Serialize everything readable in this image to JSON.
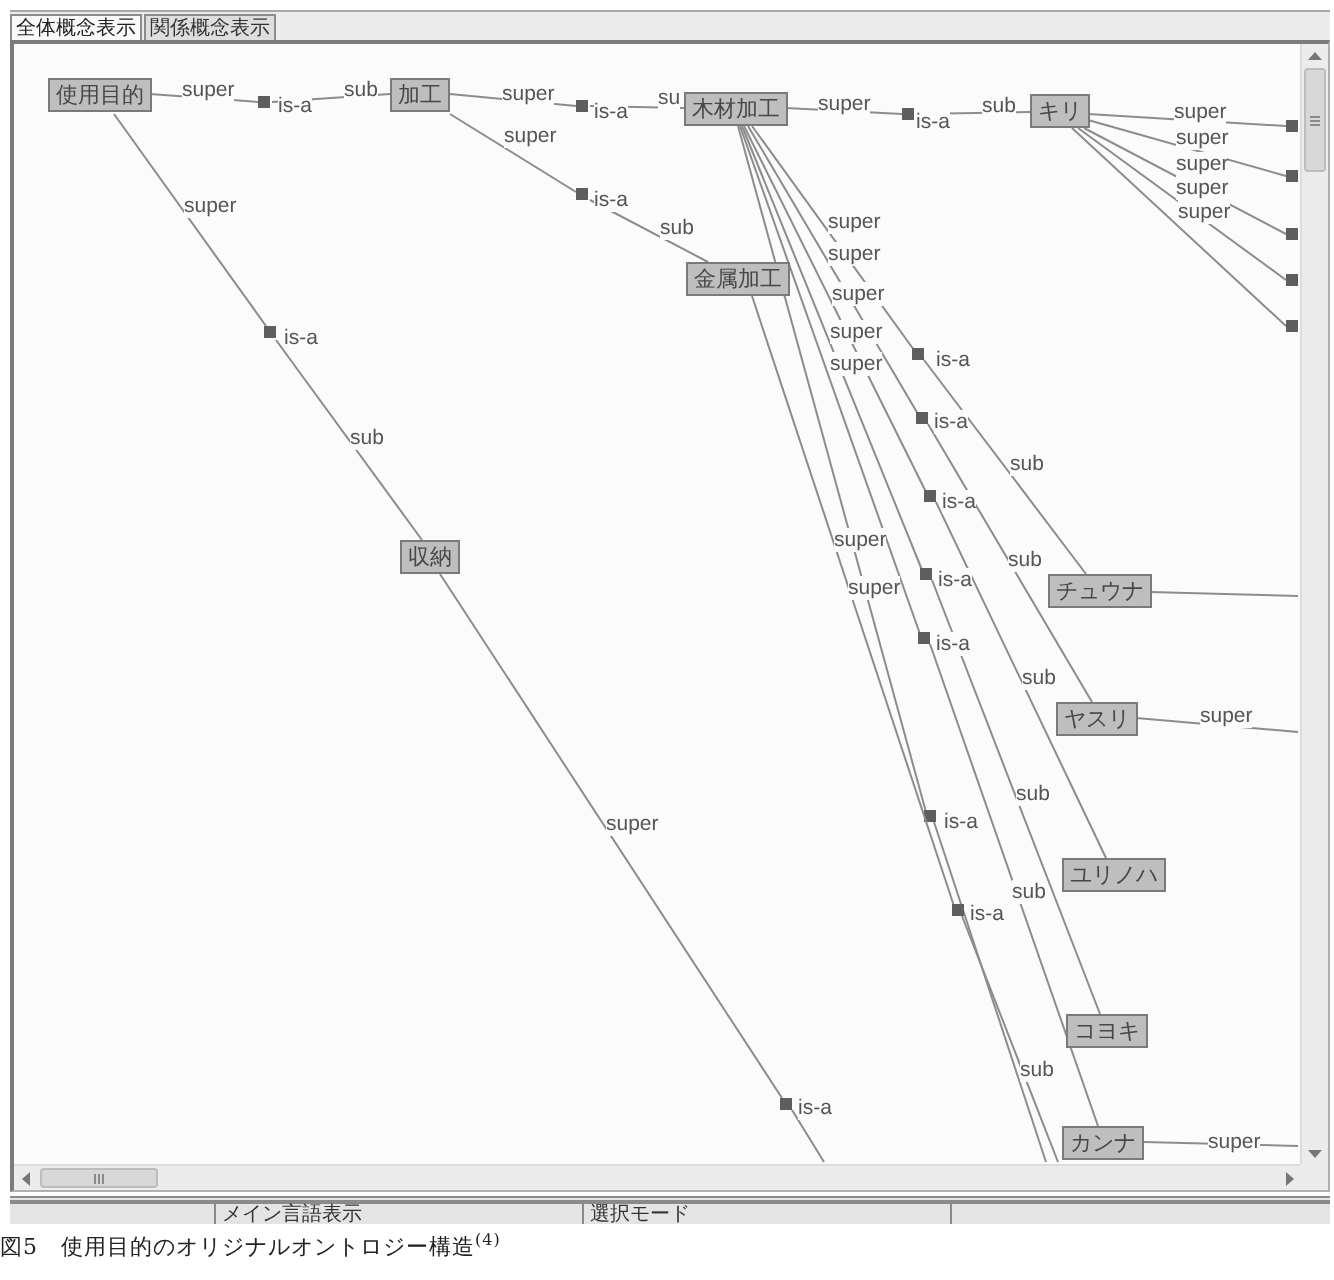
{
  "tabs": [
    {
      "label": "全体概念表示",
      "selected": true
    },
    {
      "label": "関係概念表示",
      "selected": false
    }
  ],
  "diagram": {
    "nodes": [
      {
        "label": "使用目的"
      },
      {
        "label": "加工"
      },
      {
        "label": "木材加工"
      },
      {
        "label": "キリ"
      },
      {
        "label": "金属加工"
      },
      {
        "label": "収納"
      },
      {
        "label": "チュウナ"
      },
      {
        "label": "ヤスリ"
      },
      {
        "label": "ユリノハ"
      },
      {
        "label": "コヨキ"
      },
      {
        "label": "カンナ"
      }
    ],
    "relations": [
      {
        "super": "super",
        "marker": "is-a",
        "sub": "sub"
      },
      {
        "super": "super",
        "marker": "is-a",
        "sub": "su"
      },
      {
        "super": "super",
        "marker": "is-a",
        "sub": "sub"
      },
      {
        "super": "super"
      },
      {
        "super": "super"
      },
      {
        "super": "super"
      },
      {
        "super": "super"
      },
      {
        "super": "super"
      },
      {
        "super": "super",
        "marker": "is-a",
        "sub": "sub"
      },
      {
        "super": "super",
        "marker": "is-a",
        "sub": "sub"
      },
      {
        "super": "super",
        "marker": "is-a"
      },
      {
        "super": "super",
        "marker": "is-a",
        "sub": "sub"
      },
      {
        "super": "super",
        "marker": "is-a",
        "sub": "sub"
      },
      {
        "super": "super",
        "marker": "is-a",
        "sub": "sub"
      },
      {
        "super": "super",
        "marker": "is-a",
        "sub": "sub"
      },
      {
        "super": "super",
        "marker": "is-a",
        "sub": "sub"
      },
      {
        "super": "super",
        "marker": "is-a",
        "sub": "sub"
      },
      {
        "super": "super",
        "marker": "is-a"
      },
      {
        "super": "super"
      },
      {
        "super": "super"
      }
    ]
  },
  "status_bar": {
    "panels": [
      "メイン言語表示",
      "選択モード"
    ]
  },
  "caption": "図5　使用目的のオリジナルオントロジー構造$^{(4)}$"
}
